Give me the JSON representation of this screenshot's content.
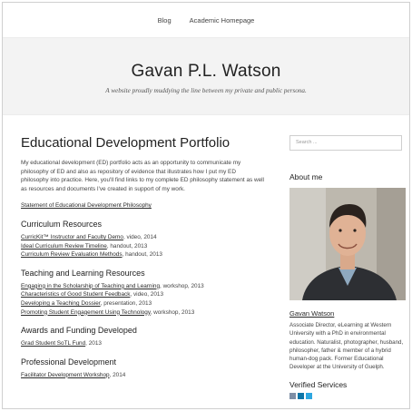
{
  "nav": {
    "items": [
      "Blog",
      "Academic Homepage"
    ]
  },
  "header": {
    "title": "Gavan P.L. Watson",
    "tagline": "A website proudly muddying the line between my private and public persona."
  },
  "main": {
    "title": "Educational Development Portfolio",
    "intro": "My educational development (ED) portfolio acts as an opportunity to communicate my philosophy of ED and also as repository of evidence that illustrates how I put my ED philosophy into practice. Here, you'll find links to my complete ED philosophy statement as well as resources and documents I've created in support of my work.",
    "philosophy_link": "Statement of Educational Development Philosophy",
    "sections": {
      "curriculum": {
        "heading": "Curriculum Resources",
        "items": [
          {
            "link": "CurricKit™ Instructor and Faculty Demo",
            "suffix": ", video, 2014"
          },
          {
            "link": "Ideal Curriculum Review Timeline",
            "suffix": ", handout, 2013"
          },
          {
            "link": "Curriculum Review Evaluation Methods",
            "suffix": ", handout, 2013"
          }
        ]
      },
      "teaching": {
        "heading": "Teaching and Learning Resources",
        "items": [
          {
            "link": "Engaging in the Scholarship of Teaching and Learning",
            "suffix": ", workshop, 2013"
          },
          {
            "link": "Characteristics of Good Student Feedback",
            "suffix": ", video, 2013"
          },
          {
            "link": "Developing a Teaching Dossier",
            "suffix": ", presentation, 2013"
          },
          {
            "link": "Promoting Student Engagement Using Technology",
            "suffix": ", workshop, 2013"
          }
        ]
      },
      "awards": {
        "heading": "Awards and Funding Developed",
        "items": [
          {
            "link": "Grad Student SoTL Fund",
            "suffix": ", 2013"
          }
        ]
      },
      "professional": {
        "heading": "Professional Development",
        "items": [
          {
            "link": "Facilitator Development Workshop",
            "suffix": ", 2014"
          }
        ]
      }
    }
  },
  "sidebar": {
    "search_placeholder": "Search ...",
    "about_heading": "About me",
    "author_name": "Gavan Watson",
    "bio": "Associate Director, eLearning at Western University with a PhD in environmental education. Naturalist, photographer, husband, philosopher, father & member of a hybrid human-dog pack. Former Educational Developer at the University of Guelph.",
    "verified_heading": "Verified Services",
    "service_icons": [
      "email-icon",
      "linkedin-icon",
      "twitter-icon"
    ]
  }
}
